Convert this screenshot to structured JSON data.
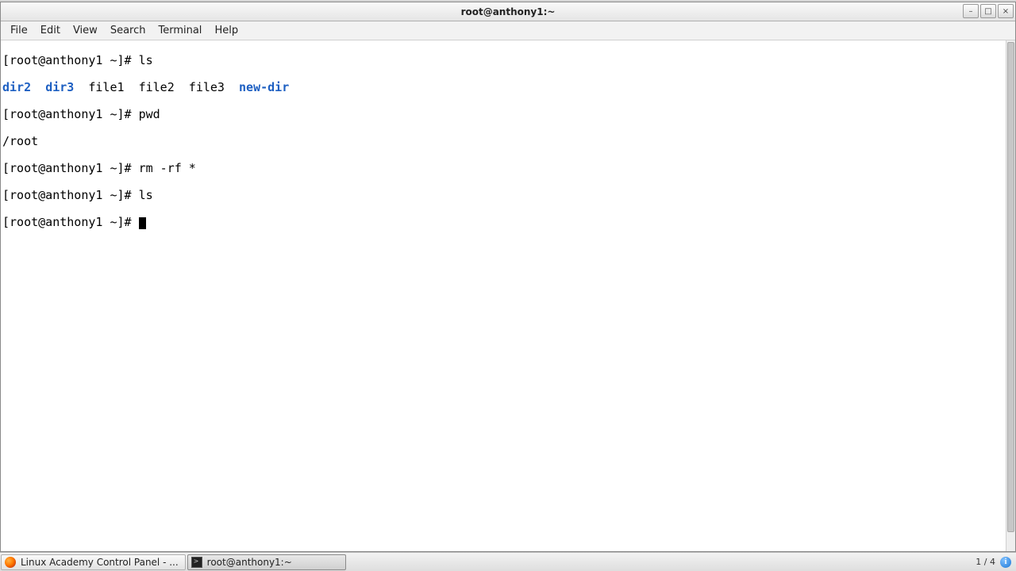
{
  "window": {
    "title": "root@anthony1:~",
    "controls": {
      "min": "–",
      "max": "□",
      "close": "×"
    }
  },
  "menu": {
    "file": "File",
    "edit": "Edit",
    "view": "View",
    "search": "Search",
    "terminal": "Terminal",
    "help": "Help"
  },
  "terminal": {
    "prompt": "[root@anthony1 ~]# ",
    "lines": {
      "l0_cmd": "ls",
      "l1_dir2": "dir2",
      "l1_sep1": "  ",
      "l1_dir3": "dir3",
      "l1_sep2": "  ",
      "l1_files": "file1  file2  file3  ",
      "l1_newdir": "new-dir",
      "l2_cmd": "pwd",
      "l3_out": "/root",
      "l4_cmd": "rm -rf *",
      "l5_cmd": "ls"
    }
  },
  "taskbar": {
    "task1": "Linux Academy Control Panel - ...",
    "task2": "root@anthony1:~",
    "workspace": "1 / 4",
    "info": "i"
  }
}
